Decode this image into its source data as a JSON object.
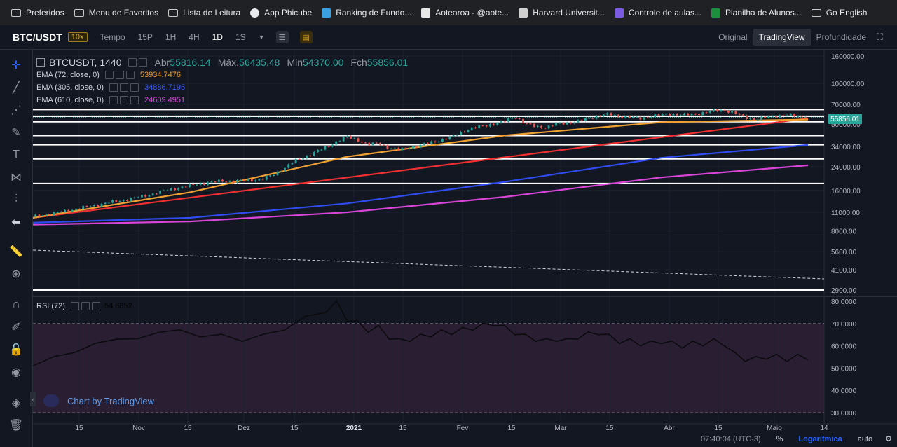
{
  "bookmarks": [
    {
      "label": "Preferidos",
      "icon": "folder-icon"
    },
    {
      "label": "Menu de Favoritos",
      "icon": "folder-icon"
    },
    {
      "label": "Lista de Leitura",
      "icon": "folder-icon"
    },
    {
      "label": "App Phicube",
      "icon": "globe-icon"
    },
    {
      "label": "Ranking de Fundo...",
      "icon": "leaf-icon"
    },
    {
      "label": "Aotearoa - @aote...",
      "icon": "warning-icon"
    },
    {
      "label": "Harvard Universit...",
      "icon": "harvard-icon"
    },
    {
      "label": "Controle de aulas...",
      "icon": "form-icon"
    },
    {
      "label": "Planilha de Alunos...",
      "icon": "sheet-icon"
    },
    {
      "label": "Go English",
      "icon": "folder-icon"
    }
  ],
  "toolbar": {
    "symbol": "BTC/USDT",
    "leverage": "10x",
    "timeframes": [
      "Tempo",
      "15P",
      "1H",
      "4H",
      "1D",
      "1S"
    ],
    "active_timeframe": "1D",
    "views": [
      "Original",
      "TradingView",
      "Profundidade"
    ],
    "active_view": "TradingView"
  },
  "legend": {
    "symbol": "BTCUSDT, 1440",
    "open_label": "Abr",
    "open": "55816.14",
    "high_label": "Máx.",
    "high": "56435.48",
    "low_label": "Min",
    "low": "54370.00",
    "close_label": "Fch",
    "close": "55856.01",
    "emas": [
      {
        "label": "EMA (72, close, 0)",
        "value": "53934.7476",
        "color": "#f0a030"
      },
      {
        "label": "EMA (305, close, 0)",
        "value": "34886.7195",
        "color": "#2f4cf0"
      },
      {
        "label": "EMA (610, close, 0)",
        "value": "24609.4951",
        "color": "#d845d8"
      }
    ]
  },
  "price_tag": "55856.01",
  "rsi_label": "RSI (72)",
  "rsi_value": "54.6852",
  "tv_logo_text": "Chart by TradingView",
  "statusbar": {
    "time": "07:40:04 (UTC-3)",
    "percent": "%",
    "log": "Logarítmica",
    "auto": "auto"
  },
  "colors": {
    "up": "#26a69a",
    "down": "#ef5350",
    "ema72": "#f0a030",
    "ema305": "#2f4cf0",
    "ema610": "#d845d8",
    "trend": "#f03030",
    "rsi_bg": "#2a1e33"
  },
  "chart_data": {
    "type": "candlestick",
    "price_axis_labels": [
      "160000.00",
      "100000.00",
      "70000.00",
      "50000.00",
      "34000.00",
      "24000.00",
      "16000.00",
      "11000.00",
      "8000.00",
      "5600.00",
      "4100.00",
      "2900.00"
    ],
    "price_axis_scale": "log",
    "rsi_axis_labels": [
      "80.0000",
      "70.0000",
      "60.0000",
      "50.0000",
      "40.0000",
      "30.0000"
    ],
    "time_axis_labels": [
      "15",
      "Nov",
      "15",
      "Dez",
      "15",
      "2021",
      "15",
      "Fev",
      "15",
      "Mar",
      "15",
      "Abr",
      "15",
      "Maio",
      "14"
    ],
    "price_path": [
      [
        0,
        10200
      ],
      [
        4,
        10500
      ],
      [
        8,
        10800
      ],
      [
        12,
        11200
      ],
      [
        16,
        11600
      ],
      [
        20,
        12000
      ],
      [
        24,
        12400
      ],
      [
        28,
        12900
      ],
      [
        32,
        13300
      ],
      [
        36,
        13700
      ],
      [
        40,
        14200
      ],
      [
        44,
        14800
      ],
      [
        48,
        15500
      ],
      [
        52,
        16200
      ],
      [
        56,
        16800
      ],
      [
        60,
        17400
      ],
      [
        64,
        18000
      ],
      [
        68,
        18400
      ],
      [
        72,
        18800
      ],
      [
        76,
        18700
      ],
      [
        80,
        18900
      ],
      [
        84,
        19100
      ],
      [
        88,
        19500
      ],
      [
        92,
        21000
      ],
      [
        96,
        23500
      ],
      [
        100,
        26500
      ],
      [
        104,
        28500
      ],
      [
        108,
        31000
      ],
      [
        112,
        33500
      ],
      [
        116,
        37000
      ],
      [
        120,
        40000
      ],
      [
        124,
        38000
      ],
      [
        128,
        35000
      ],
      [
        132,
        36000
      ],
      [
        136,
        33000
      ],
      [
        140,
        32000
      ],
      [
        144,
        33500
      ],
      [
        148,
        34500
      ],
      [
        152,
        36500
      ],
      [
        156,
        38000
      ],
      [
        160,
        40000
      ],
      [
        164,
        44000
      ],
      [
        168,
        46500
      ],
      [
        172,
        48500
      ],
      [
        176,
        50000
      ],
      [
        180,
        52000
      ],
      [
        184,
        57000
      ],
      [
        188,
        50000
      ],
      [
        192,
        48000
      ],
      [
        196,
        47000
      ],
      [
        200,
        50000
      ],
      [
        204,
        51000
      ],
      [
        208,
        52000
      ],
      [
        212,
        55000
      ],
      [
        216,
        57500
      ],
      [
        220,
        59000
      ],
      [
        224,
        57000
      ],
      [
        228,
        56000
      ],
      [
        232,
        55000
      ],
      [
        236,
        57000
      ],
      [
        240,
        58500
      ],
      [
        244,
        59500
      ],
      [
        248,
        58000
      ],
      [
        252,
        59000
      ],
      [
        256,
        60500
      ],
      [
        260,
        62500
      ],
      [
        264,
        63500
      ],
      [
        268,
        60000
      ],
      [
        272,
        56000
      ],
      [
        276,
        54000
      ],
      [
        280,
        56000
      ],
      [
        284,
        57500
      ],
      [
        288,
        58000
      ],
      [
        292,
        57000
      ],
      [
        296,
        56000
      ]
    ],
    "rsi_path": [
      [
        0,
        52
      ],
      [
        8,
        54
      ],
      [
        16,
        58
      ],
      [
        24,
        60
      ],
      [
        32,
        64
      ],
      [
        40,
        62
      ],
      [
        48,
        67
      ],
      [
        56,
        66
      ],
      [
        64,
        65
      ],
      [
        72,
        64
      ],
      [
        80,
        63
      ],
      [
        88,
        64
      ],
      [
        96,
        68
      ],
      [
        104,
        72
      ],
      [
        112,
        76
      ],
      [
        116,
        79
      ],
      [
        120,
        72
      ],
      [
        124,
        70
      ],
      [
        128,
        67
      ],
      [
        132,
        68
      ],
      [
        136,
        64
      ],
      [
        140,
        62
      ],
      [
        144,
        63
      ],
      [
        148,
        64
      ],
      [
        152,
        65
      ],
      [
        156,
        66
      ],
      [
        160,
        66
      ],
      [
        164,
        67
      ],
      [
        168,
        68
      ],
      [
        172,
        69
      ],
      [
        176,
        70
      ],
      [
        180,
        68
      ],
      [
        184,
        66
      ],
      [
        188,
        64
      ],
      [
        192,
        63
      ],
      [
        196,
        62
      ],
      [
        200,
        63
      ],
      [
        204,
        62
      ],
      [
        208,
        64
      ],
      [
        212,
        65
      ],
      [
        216,
        66
      ],
      [
        220,
        64
      ],
      [
        224,
        62
      ],
      [
        228,
        62
      ],
      [
        232,
        61
      ],
      [
        236,
        61
      ],
      [
        240,
        62
      ],
      [
        244,
        61
      ],
      [
        248,
        60
      ],
      [
        252,
        61
      ],
      [
        256,
        61
      ],
      [
        260,
        62
      ],
      [
        264,
        61
      ],
      [
        268,
        56
      ],
      [
        272,
        54
      ],
      [
        276,
        54
      ],
      [
        280,
        55
      ],
      [
        284,
        55
      ],
      [
        288,
        54
      ],
      [
        292,
        55
      ],
      [
        296,
        54.7
      ]
    ],
    "ema72": [
      [
        0,
        10000
      ],
      [
        60,
        15500
      ],
      [
        120,
        28500
      ],
      [
        180,
        41000
      ],
      [
        240,
        51500
      ],
      [
        296,
        53934
      ]
    ],
    "ema305": [
      [
        0,
        9200
      ],
      [
        60,
        10000
      ],
      [
        120,
        12800
      ],
      [
        180,
        18500
      ],
      [
        240,
        28000
      ],
      [
        296,
        34886
      ]
    ],
    "ema610": [
      [
        0,
        8900
      ],
      [
        60,
        9400
      ],
      [
        120,
        11000
      ],
      [
        180,
        14300
      ],
      [
        240,
        20000
      ],
      [
        296,
        24609
      ]
    ],
    "trend_red": [
      [
        0,
        10000
      ],
      [
        296,
        55000
      ]
    ],
    "horizontal_levels": [
      64000,
      57000,
      52000,
      41000,
      35000,
      27500,
      18000,
      2900
    ]
  }
}
